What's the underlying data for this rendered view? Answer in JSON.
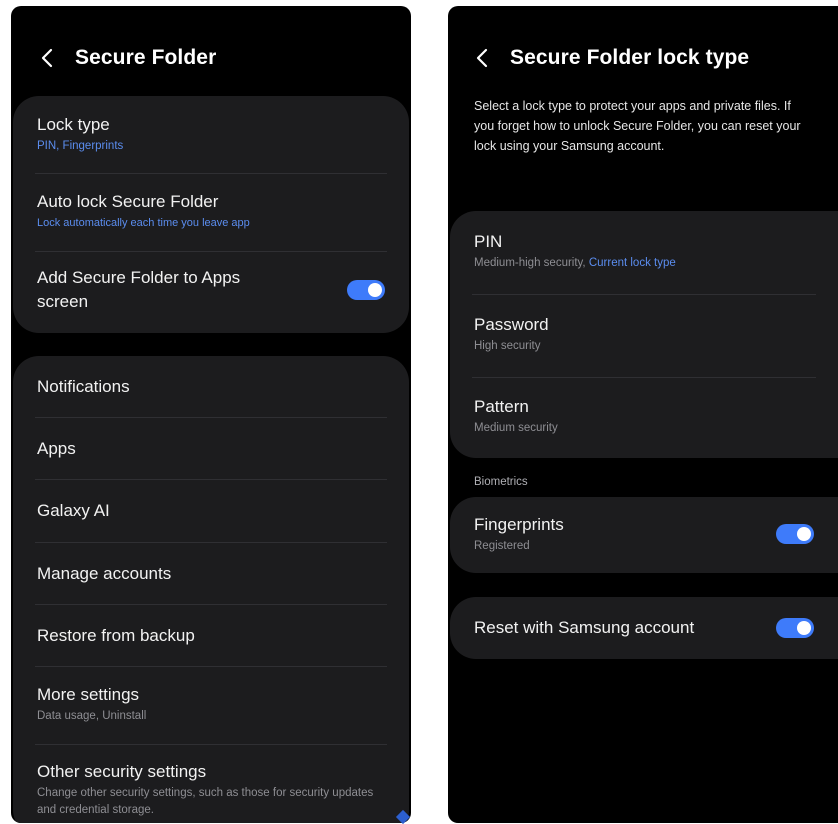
{
  "left_screen": {
    "title": "Secure Folder",
    "group1": [
      {
        "title": "Lock type",
        "subtitle": "PIN, Fingerprints"
      },
      {
        "title": "Auto lock Secure Folder",
        "subtitle": "Lock automatically each time you leave app"
      },
      {
        "title": "Add Secure Folder to Apps screen",
        "toggle_on": true
      }
    ],
    "group2": [
      {
        "title": "Notifications"
      },
      {
        "title": "Apps"
      },
      {
        "title": "Galaxy AI"
      },
      {
        "title": "Manage accounts"
      },
      {
        "title": "Restore from backup"
      },
      {
        "title": "More settings",
        "subtitle": "Data usage, Uninstall"
      },
      {
        "title": "Other security settings",
        "subtitle": "Change other security settings, such as those for security updates and credential storage."
      }
    ]
  },
  "right_screen": {
    "title": "Secure Folder lock type",
    "description": "Select a lock type to protect your apps and private files. If you forget how to unlock Secure Folder, you can reset your lock using your Samsung account.",
    "lock_types": [
      {
        "title": "PIN",
        "subtitle": "Medium-high security, ",
        "subtitle_accent": "Current lock type"
      },
      {
        "title": "Password",
        "subtitle": "High security"
      },
      {
        "title": "Pattern",
        "subtitle": "Medium security"
      }
    ],
    "biometrics_label": "Biometrics",
    "fingerprints": {
      "title": "Fingerprints",
      "subtitle": "Registered",
      "toggle_on": true
    },
    "reset": {
      "title": "Reset with Samsung account",
      "toggle_on": true
    }
  },
  "colors": {
    "background": "#000000",
    "card": "#1c1c1e",
    "accent": "#5b8def",
    "toggle": "#3e7bfa"
  },
  "icons": [
    "back-arrow-icon"
  ]
}
